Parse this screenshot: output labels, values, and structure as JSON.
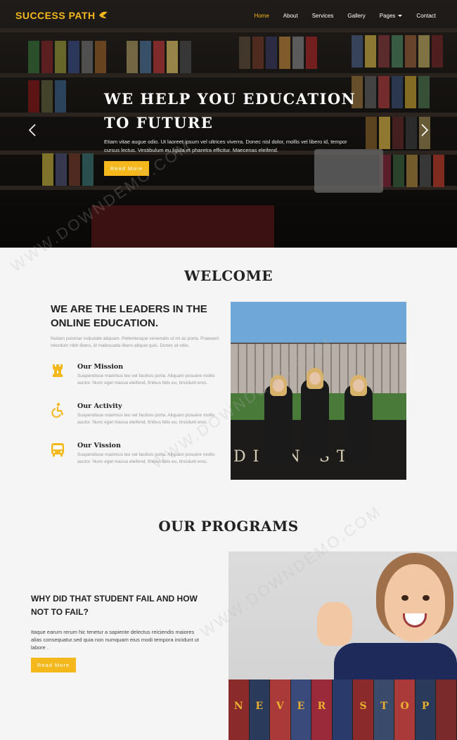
{
  "brand": {
    "name": "SUCCESS PATH",
    "accent": "#f5b81c"
  },
  "nav": {
    "items": [
      {
        "label": "Home",
        "active": true
      },
      {
        "label": "About",
        "active": false
      },
      {
        "label": "Services",
        "active": false
      },
      {
        "label": "Gallery",
        "active": false
      },
      {
        "label": "Pages",
        "active": false,
        "dropdown": true
      },
      {
        "label": "Contact",
        "active": false
      }
    ]
  },
  "hero": {
    "title_line1": "WE HELP YOU EDUCATION",
    "title_line2": "TO FUTURE",
    "text": "Etiam vitae augue odio. Ut laoreet ipsum vel ultrices viverra. Donec nisl dolor, mollis vel libero id, tempor cursus lectus. Vestibulum eu ligula et pharetra efficitur. Maecenas eleifend.",
    "button": "Read More"
  },
  "welcome": {
    "title": "WELCOME",
    "heading": "WE ARE THE LEADERS IN THE ONLINE EDUCATION.",
    "text": "Nullam pulvinar vulputate aliquam. Pellentesque venenatis ut mi ac porta. Praesent interdum nibh libero, id malesuada libero aliquet quis. Donec at odio.",
    "features": [
      {
        "title": "Our Mission",
        "icon": "rook-icon",
        "text": "Suspendisse maximus leo vel facilisis porta. Aliquam posuere mollis auctor. Nunc eget massa eleifend, finibus felis eu, tincidunt eros."
      },
      {
        "title": "Our Activity",
        "icon": "wheelchair-icon",
        "text": "Suspendisse maximus leo vel facilisis porta. Aliquam posuere mollis auctor. Nunc eget massa eleifend, finibus felis eu, tincidunt eros."
      },
      {
        "title": "Our Vission",
        "icon": "bus-icon",
        "text": "Suspendisse maximus leo vel facilisis porta. Aliquam posuere mollis auctor. Nunc eget massa eleifend, finibus felis eu, tincidunt eros."
      }
    ],
    "photo_sign": "DINN ST"
  },
  "programs": {
    "title": "OUR PROGRAMS",
    "heading": "WHY DID THAT STUDENT FAIL AND HOW NOT TO FAIL?",
    "text": "Itaque earum rerum hic tenetur a sapiente delectus reiciendis maiores alias consequatur.sed quia non numquam eius modi tempora incidunt ut labore .",
    "button": "Read More",
    "book_letters": [
      "N",
      "E",
      "V",
      "E",
      "R",
      "",
      "S",
      "T",
      "O",
      "P",
      ""
    ]
  },
  "watermark": "WWW.DOWNDEMO.COM"
}
